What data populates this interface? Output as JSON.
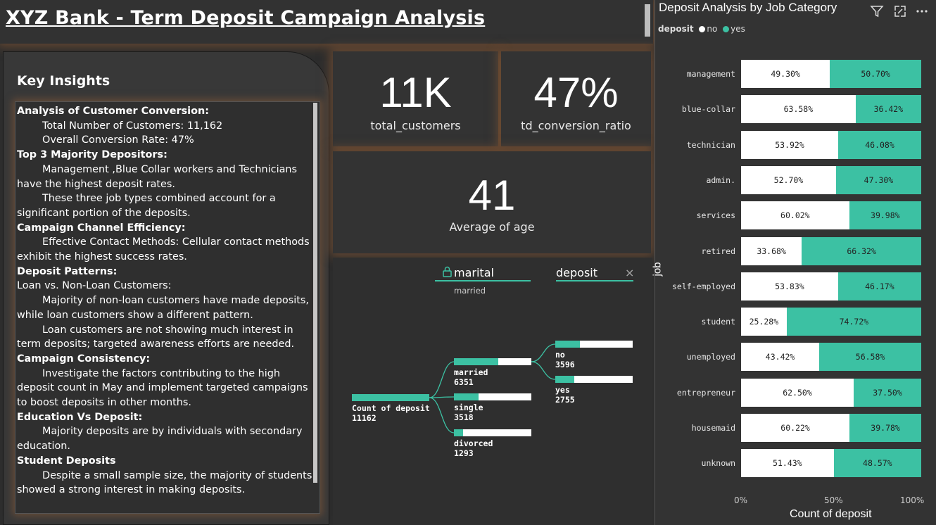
{
  "report": {
    "title": "XYZ Bank - Term Deposit Campaign Analysis"
  },
  "insights": {
    "heading": "Key Insights",
    "lines": [
      {
        "text": "Analysis of Customer Conversion:",
        "style": "h"
      },
      {
        "text": "Total Number of Customers: 11,162",
        "style": "i"
      },
      {
        "text": "Overall Conversion Rate: 47%",
        "style": "i"
      },
      {
        "text": "Top 3 Majority Depositors:",
        "style": "h"
      },
      {
        "text": "Management ,Blue Collar workers and Technicians have the highest deposit rates.",
        "style": "i"
      },
      {
        "text": "These three job types combined account for a significant portion of the deposits.",
        "style": "i"
      },
      {
        "text": "Campaign Channel Efficiency:",
        "style": "h"
      },
      {
        "text": "Effective Contact Methods: Cellular contact methods exhibit the highest success rates.",
        "style": "i"
      },
      {
        "text": "Deposit Patterns:",
        "style": "h"
      },
      {
        "text": "Loan vs. Non-Loan Customers:",
        "style": ""
      },
      {
        "text": "Majority of non-loan customers have made deposits, while loan customers show a different pattern.",
        "style": "i"
      },
      {
        "text": "Loan customers are not showing much interest in term deposits; targeted awareness efforts are needed.",
        "style": "i"
      },
      {
        "text": "Campaign Consistency:",
        "style": "h"
      },
      {
        "text": "Investigate the factors contributing to the high deposit count in May and implement targeted campaigns to boost deposits in other months.",
        "style": "i"
      },
      {
        "text": "Education Vs Deposit:",
        "style": "h"
      },
      {
        "text": "Majority deposits are by individuals with secondary education.",
        "style": "i"
      },
      {
        "text": "Student Deposits",
        "style": "h"
      },
      {
        "text": "Despite a small sample size, the majority of students showed a strong interest in making deposits.",
        "style": "i"
      }
    ]
  },
  "kpis": {
    "total_customers": {
      "value": "11K",
      "label": "total_customers"
    },
    "conversion": {
      "value": "47%",
      "label": "td_conversion_ratio"
    },
    "age": {
      "value": "41",
      "label": "Average of age"
    }
  },
  "decomp": {
    "level1": "marital",
    "level1_value": "married",
    "level2": "deposit",
    "close_glyph": "×",
    "lock_icon": "lock-icon",
    "root": {
      "name": "Count of deposit",
      "value": "11162",
      "share": 1.0
    },
    "marital": [
      {
        "name": "married",
        "value": "6351",
        "share": 0.569
      },
      {
        "name": "single",
        "value": "3518",
        "share": 0.315
      },
      {
        "name": "divorced",
        "value": "1293",
        "share": 0.116
      }
    ],
    "deposit": [
      {
        "name": "no",
        "value": "3596",
        "share": 0.322
      },
      {
        "name": "yes",
        "value": "2755",
        "share": 0.247
      }
    ]
  },
  "jobchart": {
    "title": "Deposit Analysis by Job Category",
    "legend_title": "deposit",
    "legend": [
      {
        "name": "no",
        "color": "#ffffff"
      },
      {
        "name": "yes",
        "color": "#3cc1a3"
      }
    ],
    "icons": [
      "filter-icon",
      "focus-mode-icon",
      "more-options-icon"
    ]
  },
  "chart_data": {
    "type": "bar",
    "orientation": "horizontal",
    "stacked": "100%",
    "title": "Deposit Analysis by Job Category",
    "xlabel": "Count of deposit",
    "ylabel": "job",
    "xticks": [
      "0%",
      "50%",
      "100%"
    ],
    "xlim": [
      0,
      100
    ],
    "categories": [
      "management",
      "blue-collar",
      "technician",
      "admin.",
      "services",
      "retired",
      "self-employed",
      "student",
      "unemployed",
      "entrepreneur",
      "housemaid",
      "unknown"
    ],
    "series": [
      {
        "name": "no",
        "color": "#ffffff",
        "values": [
          49.3,
          63.58,
          53.92,
          52.7,
          60.02,
          33.68,
          53.83,
          25.28,
          43.42,
          62.5,
          60.22,
          51.43
        ],
        "labels": [
          "49.30%",
          "63.58%",
          "53.92%",
          "52.70%",
          "60.02%",
          "33.68%",
          "53.83%",
          "25.28%",
          "43.42%",
          "62.50%",
          "60.22%",
          "51.43%"
        ]
      },
      {
        "name": "yes",
        "color": "#3cc1a3",
        "values": [
          50.7,
          36.42,
          46.08,
          47.3,
          39.98,
          66.32,
          46.17,
          74.72,
          56.58,
          37.5,
          39.78,
          48.57
        ],
        "labels": [
          "50.70%",
          "36.42%",
          "46.08%",
          "47.30%",
          "39.98%",
          "66.32%",
          "46.17%",
          "74.72%",
          "56.58%",
          "37.50%",
          "39.78%",
          "48.57%"
        ]
      }
    ]
  }
}
